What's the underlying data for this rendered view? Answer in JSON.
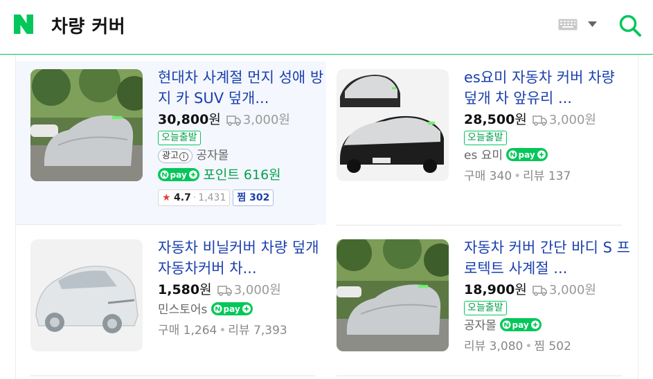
{
  "header": {
    "logo_icon": "naver-n-logo",
    "query": "차량 커버",
    "keyboard_icon": "keyboard-icon",
    "dropdown_icon": "caret-down-icon",
    "search_icon": "search-icon",
    "brand_color": "#03c75a"
  },
  "products": [
    {
      "title": "현대차 사계절 먼지 성애 방지 카 SUV 덮개...",
      "price": "30,800",
      "won": "원",
      "shipping": "3,000원",
      "badge": "오늘출발",
      "ad_label": "광고",
      "seller": "공자몰",
      "npay_label": "N pay+",
      "point_label": "포인트 616원",
      "rating": "4.7",
      "rating_count": "1,431",
      "zzim": "찜 302"
    },
    {
      "title": "es요미 자동차 커버 차량 덮개 차 앞유리 ...",
      "price": "28,500",
      "won": "원",
      "shipping": "3,000원",
      "badge": "오늘출발",
      "seller": "es 요미",
      "npay_label": "N pay+",
      "stats": [
        "구매 340",
        "리뷰 137"
      ]
    },
    {
      "title": "자동차 비닐커버 차량 덮개 자동차커버 차...",
      "price": "1,580",
      "won": "원",
      "shipping": "3,000원",
      "seller": "민스토어s",
      "npay_label": "N pay+",
      "stats": [
        "구매 1,264",
        "리뷰 7,393"
      ]
    },
    {
      "title": "자동차 커버 간단 바디 S 프로텍트 사계절 ...",
      "price": "18,900",
      "won": "원",
      "shipping": "3,000원",
      "badge": "오늘출발",
      "seller": "공자몰",
      "npay_label": "N pay+",
      "stats": [
        "리뷰 3,080",
        "찜 502"
      ]
    }
  ]
}
